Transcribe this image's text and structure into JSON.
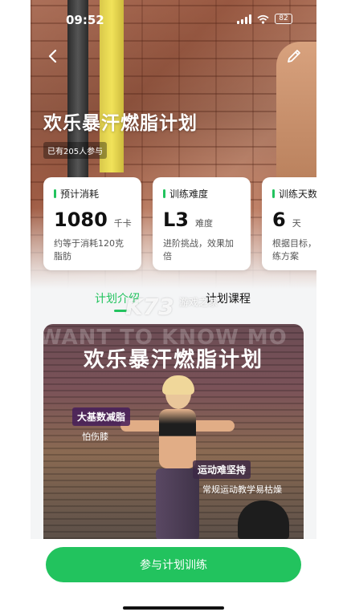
{
  "status_bar": {
    "time": "09:52",
    "battery": "82"
  },
  "header": {
    "back_icon": "chevron-left-icon",
    "edit_icon": "pencil-icon"
  },
  "plan": {
    "title": "欢乐暴汗燃脂计划",
    "participants": "已有205人参与"
  },
  "stats": [
    {
      "label": "预计消耗",
      "value": "1080",
      "unit": "千卡",
      "desc": "约等于消耗120克脂肪"
    },
    {
      "label": "训练难度",
      "value": "L3",
      "unit": "难度",
      "desc": "进阶挑战，效果加倍"
    },
    {
      "label": "训练天数",
      "value": "6",
      "unit": "天",
      "desc": "根据目标，专属训练方案"
    }
  ],
  "tabs": [
    {
      "label": "计划介绍",
      "active": true
    },
    {
      "label": "计划课程",
      "active": false
    }
  ],
  "watermark": {
    "logo": "K73",
    "text": "游戏之家"
  },
  "banner": {
    "bg_text": "WANT TO KNOW MO",
    "title": "欢乐暴汗燃脂计划",
    "tags": [
      {
        "main": "大基数减脂",
        "sub": "怕伤膝"
      },
      {
        "main": "运动难坚持",
        "sub": "常规运动教学易枯燥"
      }
    ]
  },
  "action": {
    "join_label": "参与计划训练"
  },
  "colors": {
    "accent": "#22c35e"
  }
}
